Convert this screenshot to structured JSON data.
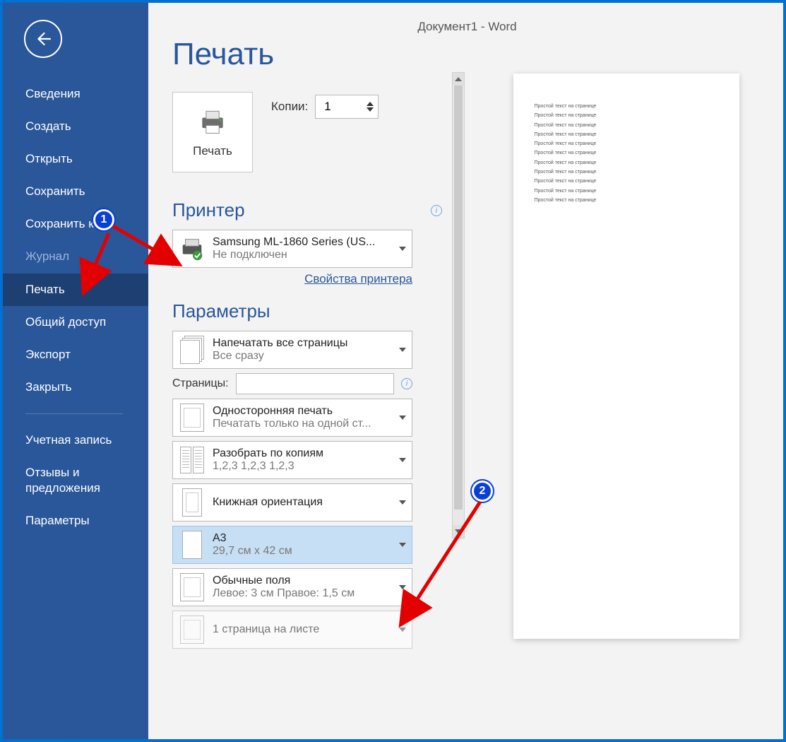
{
  "titlebar": "Документ1  -  Word",
  "sidebar": {
    "items": [
      {
        "label": "Сведения",
        "active": false
      },
      {
        "label": "Создать",
        "active": false
      },
      {
        "label": "Открыть",
        "active": false
      },
      {
        "label": "Сохранить",
        "active": false
      },
      {
        "label": "Сохранить как",
        "active": false
      },
      {
        "label": "Журнал",
        "active": false,
        "dim": true
      },
      {
        "label": "Печать",
        "active": true
      },
      {
        "label": "Общий доступ",
        "active": false
      },
      {
        "label": "Экспорт",
        "active": false
      },
      {
        "label": "Закрыть",
        "active": false
      }
    ],
    "bottom": [
      {
        "label": "Учетная запись"
      },
      {
        "label": "Отзывы и предложения"
      },
      {
        "label": "Параметры"
      }
    ]
  },
  "print": {
    "title": "Печать",
    "button_label": "Печать",
    "copies_label": "Копии:",
    "copies_value": "1"
  },
  "printer": {
    "header": "Принтер",
    "name": "Samsung ML-1860 Series (US...",
    "status": "Не подключен",
    "properties_link": "Свойства принтера"
  },
  "settings": {
    "header": "Параметры",
    "print_all": {
      "line1": "Напечатать все страницы",
      "line2": "Все сразу"
    },
    "pages_label": "Страницы:",
    "pages_value": "",
    "sides": {
      "line1": "Односторонняя печать",
      "line2": "Печатать только на одной ст..."
    },
    "collate": {
      "line1": "Разобрать по копиям",
      "line2": "1,2,3    1,2,3    1,2,3"
    },
    "orientation": {
      "line1": "Книжная ориентация",
      "line2": ""
    },
    "papersize": {
      "line1": "A3",
      "line2": "29,7 см x 42 см"
    },
    "margins": {
      "line1": "Обычные поля",
      "line2": "Левое:  3 см    Правое:  1,5 см"
    },
    "per_sheet": {
      "line1": "1 страница на листе",
      "line2": ""
    }
  },
  "preview": {
    "line": "Простой текст на странице",
    "repeat": 11
  },
  "annotations": {
    "badge1": "1",
    "badge2": "2"
  }
}
